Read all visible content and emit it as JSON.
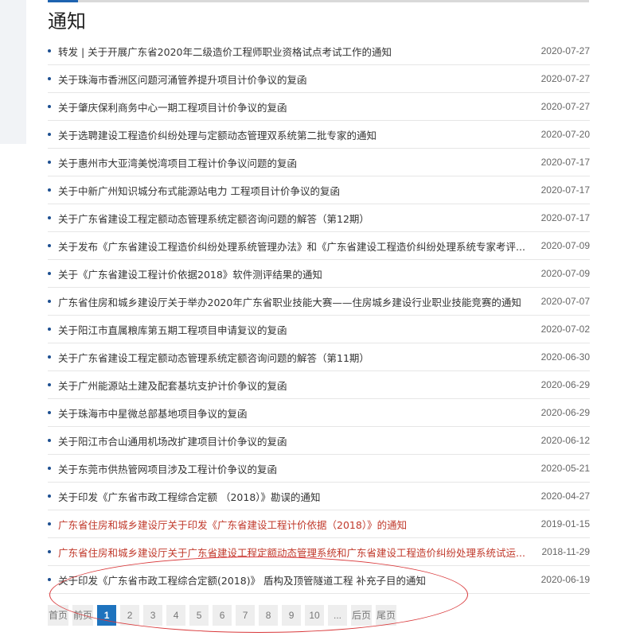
{
  "page": {
    "title": "通知"
  },
  "notices": [
    {
      "title": "转发 | 关于开展广东省2020年二级造价工程师职业资格试点考试工作的通知",
      "date": "2020-07-27",
      "highlight": false
    },
    {
      "title": "关于珠海市香洲区问题河涌管养提升项目计价争议的复函",
      "date": "2020-07-27",
      "highlight": false
    },
    {
      "title": "关于肇庆保利商务中心一期工程项目计价争议的复函",
      "date": "2020-07-27",
      "highlight": false
    },
    {
      "title": "关于选聘建设工程造价纠纷处理与定额动态管理双系统第二批专家的通知",
      "date": "2020-07-20",
      "highlight": false
    },
    {
      "title": "关于惠州市大亚湾美悦湾项目工程计价争议问题的复函",
      "date": "2020-07-17",
      "highlight": false
    },
    {
      "title": "关于中新广州知识城分布式能源站电力 工程项目计价争议的复函",
      "date": "2020-07-17",
      "highlight": false
    },
    {
      "title": "关于广东省建设工程定额动态管理系统定额咨询问题的解答（第12期）",
      "date": "2020-07-17",
      "highlight": false
    },
    {
      "title": "关于发布《广东省建设工程造价纠纷处理系统管理办法》和《广东省建设工程造价纠纷处理系统专家考评...",
      "date": "2020-07-09",
      "highlight": false
    },
    {
      "title": "关于《广东省建设工程计价依据2018》软件测评结果的通知",
      "date": "2020-07-09",
      "highlight": false
    },
    {
      "title": "广东省住房和城乡建设厅关于举办2020年广东省职业技能大赛——住房城乡建设行业职业技能竞赛的通知",
      "date": "2020-07-07",
      "highlight": false
    },
    {
      "title": "关于阳江市直属粮库第五期工程项目申请复议的复函",
      "date": "2020-07-02",
      "highlight": false
    },
    {
      "title": "关于广东省建设工程定额动态管理系统定额咨询问题的解答（第11期）",
      "date": "2020-06-30",
      "highlight": false
    },
    {
      "title": "关于广州能源站土建及配套基坑支护计价争议的复函",
      "date": "2020-06-29",
      "highlight": false
    },
    {
      "title": "关于珠海市中星微总部基地项目争议的复函",
      "date": "2020-06-29",
      "highlight": false
    },
    {
      "title": "关于阳江市合山通用机场改扩建项目计价争议的复函",
      "date": "2020-06-12",
      "highlight": false
    },
    {
      "title": "关于东莞市供热管网项目涉及工程计价争议的复函",
      "date": "2020-05-21",
      "highlight": false
    },
    {
      "title": "关于印发《广东省市政工程综合定额 （2018）》勘误的通知",
      "date": "2020-04-27",
      "highlight": false
    },
    {
      "title": "广东省住房和城乡建设厅关于印发《广东省建设工程计价依据（2018）》的通知",
      "date": "2019-01-15",
      "highlight": true
    },
    {
      "title": "广东省住房和城乡建设厅关于广东省建设工程定额动态管理系统和广东省建设工程造价纠纷处理系统试运...",
      "date": "2018-11-29",
      "highlight": true
    },
    {
      "title": "关于印发《广东省市政工程综合定额(2018)》 盾构及顶管隧道工程 补充子目的通知",
      "date": "2020-06-19",
      "highlight": false
    }
  ],
  "pagination": {
    "first": "首页",
    "prev": "前页",
    "pages": [
      "1",
      "2",
      "3",
      "4",
      "5",
      "6",
      "7",
      "8",
      "9",
      "10"
    ],
    "current": "1",
    "ellipsis": "...",
    "next": "后页",
    "last": "尾页"
  },
  "colors": {
    "accent": "#1e73be",
    "highlight_text": "#c0392b",
    "annotation_oval": "#d9383a"
  }
}
